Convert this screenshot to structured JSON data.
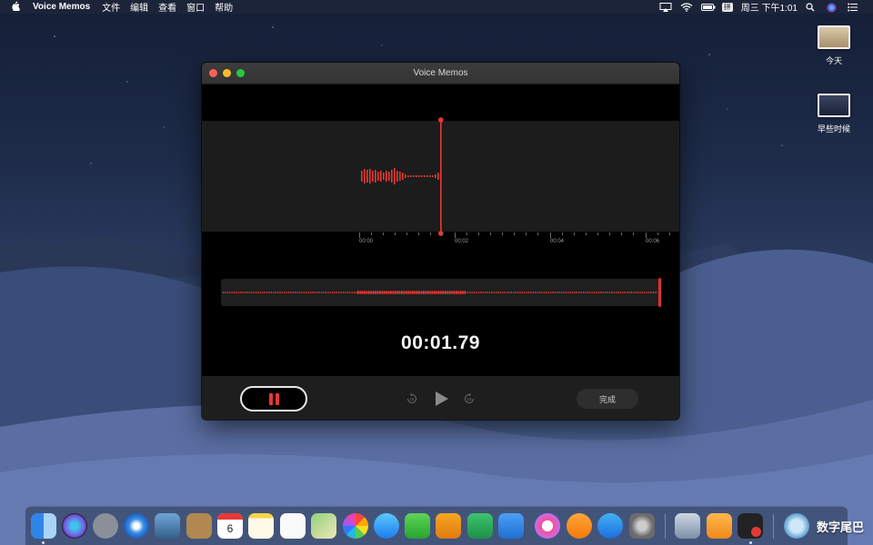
{
  "menubar": {
    "app_name": "Voice Memos",
    "menus": [
      "文件",
      "编辑",
      "查看",
      "窗口",
      "帮助"
    ],
    "ime_label": "拼",
    "clock": "周三 下午1:01"
  },
  "desktop": {
    "icons": [
      {
        "label": "今天"
      },
      {
        "label": "早些时候"
      }
    ]
  },
  "window": {
    "title": "Voice Memos",
    "timeline_ticks": [
      "00:00",
      "00:02",
      "00:04",
      "00:06"
    ],
    "elapsed_time": "00:01.79",
    "done_label": "完成"
  },
  "dock": {
    "apps": [
      "Finder",
      "Siri",
      "Launchpad",
      "Safari",
      "Preview",
      "Contacts",
      "Calendar",
      "Notes",
      "Reminders",
      "Maps",
      "Photos",
      "Messages",
      "FaceTime",
      "Pages",
      "Numbers",
      "Keynote",
      "iTunes",
      "iBooks",
      "App Store",
      "System Preferences",
      "Photo Viewer",
      "Home",
      "Voice Memos",
      "Downloads"
    ],
    "calendar_day": "6"
  },
  "watermark": "数字尾巴",
  "colors": {
    "accent_red": "#e53935",
    "window_bg": "#000000",
    "band_bg": "#1c1c1c"
  }
}
